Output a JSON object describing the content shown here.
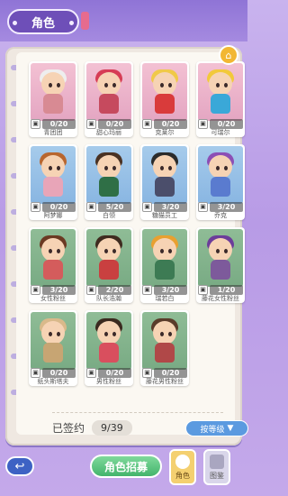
{
  "header": {
    "title": "角色"
  },
  "cards": [
    {
      "name": "青团团",
      "count": "0/20",
      "theme": "pink",
      "hair": "#eeeeee",
      "body": "#d88a93"
    },
    {
      "name": "甜心玛丽",
      "count": "0/20",
      "theme": "pink",
      "hair": "#d63d55",
      "body": "#c64a5e"
    },
    {
      "name": "克莱尔",
      "count": "0/20",
      "theme": "pink",
      "hair": "#f0c948",
      "body": "#d93b3b"
    },
    {
      "name": "可瑞尔",
      "count": "0/20",
      "theme": "pink",
      "hair": "#f2c93a",
      "body": "#3aa8d8"
    },
    {
      "name": "阿梦娜",
      "count": "0/20",
      "theme": "blue",
      "hair": "#b8662f",
      "body": "#e8a5b8"
    },
    {
      "name": "白领",
      "count": "5/20",
      "theme": "blue",
      "hair": "#4a3223",
      "body": "#2f6f46"
    },
    {
      "name": "糖猫员工",
      "count": "3/20",
      "theme": "blue",
      "hair": "#2b2b2b",
      "body": "#4b4e6b"
    },
    {
      "name": "乔克",
      "count": "3/20",
      "theme": "blue",
      "hair": "#8c4fb5",
      "body": "#5a7bcf"
    },
    {
      "name": "女性粉丝",
      "count": "3/20",
      "theme": "green",
      "hair": "#6b3a23",
      "body": "#d45c5c"
    },
    {
      "name": "队长浩瀚",
      "count": "2/20",
      "theme": "green",
      "hair": "#3f2b1f",
      "body": "#c94040"
    },
    {
      "name": "瑞若白",
      "count": "3/20",
      "theme": "green",
      "hair": "#e8a030",
      "body": "#3d7b54"
    },
    {
      "name": "藤花女性粉丝",
      "count": "1/20",
      "theme": "green",
      "hair": "#6c3d9a",
      "body": "#7d5a9b"
    },
    {
      "name": "纸头斯塔夫",
      "count": "0/20",
      "theme": "green",
      "hair": "#d9b98a",
      "body": "#c7a573"
    },
    {
      "name": "男性粉丝",
      "count": "0/20",
      "theme": "green",
      "hair": "#3b2a1f",
      "body": "#d94f5e"
    },
    {
      "name": "藤花男性粉丝",
      "count": "0/20",
      "theme": "green",
      "hair": "#5a3b2a",
      "body": "#b04848"
    }
  ],
  "footer": {
    "signed_label": "已签约",
    "signed_value": "9/39",
    "sort_label": "按等级"
  },
  "bottom": {
    "recruit_label": "角色招募",
    "tab_roles": "角色",
    "tab_album": "图鉴"
  }
}
